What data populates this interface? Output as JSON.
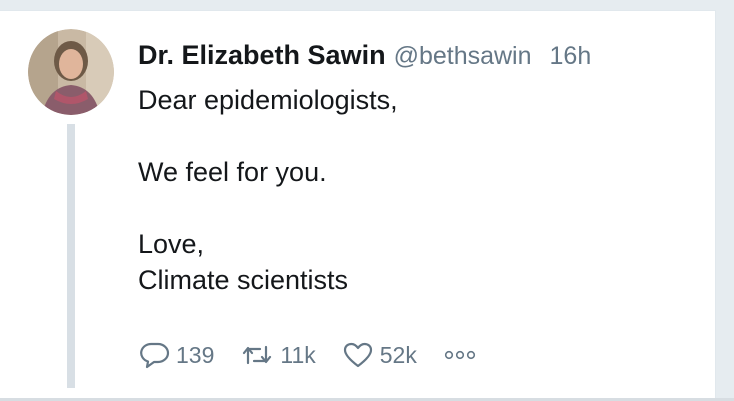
{
  "tweet": {
    "author_name": "Dr. Elizabeth Sawin",
    "handle": "@bethsawin",
    "time": "16h",
    "lines": [
      "Dear epidemiologists,",
      "",
      "We feel for you.",
      "",
      "Love,",
      "Climate scientists"
    ],
    "actions": {
      "replies": "139",
      "retweets": "11k",
      "likes": "52k"
    },
    "icons": {
      "reply": "reply-icon",
      "retweet": "retweet-icon",
      "like": "heart-icon",
      "more": "more-icon"
    }
  },
  "colors": {
    "text": "#14171a",
    "secondary": "#657786",
    "thread_line": "#d8dfe5",
    "background": "#e6ecf0"
  }
}
